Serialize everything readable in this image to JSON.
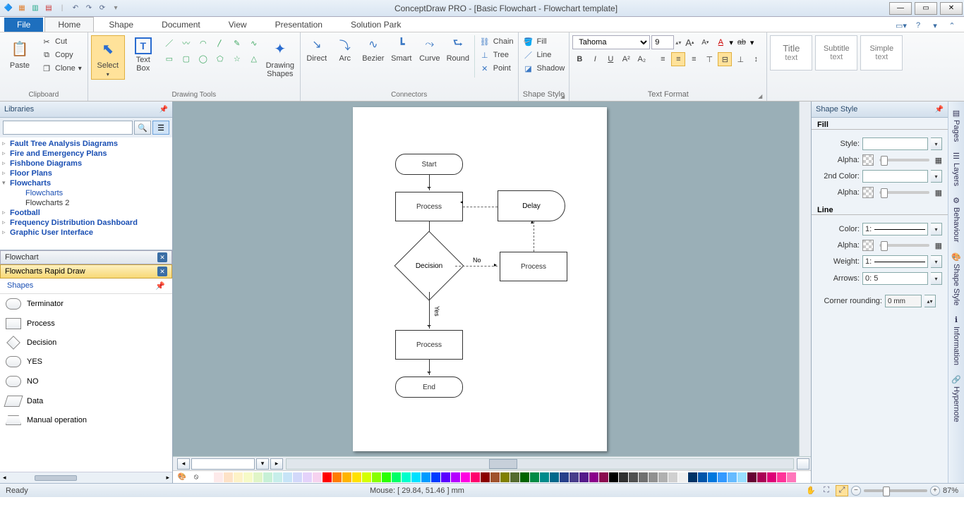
{
  "titlebar": {
    "title": "ConceptDraw PRO - [Basic Flowchart - Flowchart template]"
  },
  "menu": {
    "file": "File",
    "tabs": [
      "Home",
      "Shape",
      "Document",
      "View",
      "Presentation",
      "Solution Park"
    ],
    "active": 0
  },
  "ribbon": {
    "clipboard": {
      "label": "Clipboard",
      "paste": "Paste",
      "cut": "Cut",
      "copy": "Copy",
      "clone": "Clone"
    },
    "drawing": {
      "label": "Drawing Tools",
      "select": "Select",
      "textbox": "Text Box",
      "shapes": "Drawing Shapes"
    },
    "connectors": {
      "label": "Connectors",
      "items": [
        "Direct",
        "Arc",
        "Bezier",
        "Smart",
        "Curve",
        "Round"
      ],
      "side": [
        "Chain",
        "Tree",
        "Point"
      ]
    },
    "shapestyle": {
      "label": "Shape Style",
      "fill": "Fill",
      "line": "Line",
      "shadow": "Shadow"
    },
    "textformat": {
      "label": "Text Format",
      "font": "Tahoma",
      "size": "9"
    },
    "stylecards": {
      "title": {
        "t1": "Title",
        "t2": "text"
      },
      "subtitle": {
        "t1": "Subtitle",
        "t2": "text"
      },
      "simple": {
        "t1": "Simple",
        "t2": "text"
      }
    }
  },
  "left": {
    "hdr": "Libraries",
    "tree": [
      {
        "label": "Fault Tree Analysis Diagrams"
      },
      {
        "label": "Fire and Emergency Plans"
      },
      {
        "label": "Fishbone Diagrams"
      },
      {
        "label": "Floor Plans"
      },
      {
        "label": "Flowcharts",
        "open": true,
        "children": [
          {
            "label": "Flowcharts",
            "link": true
          },
          {
            "label": "Flowcharts 2",
            "link": false
          }
        ]
      },
      {
        "label": "Football"
      },
      {
        "label": "Frequency Distribution Dashboard"
      },
      {
        "label": "Graphic User Interface"
      }
    ],
    "stacks": [
      {
        "label": "Flowchart",
        "active": false
      },
      {
        "label": "Flowcharts Rapid Draw",
        "active": true
      }
    ],
    "shapesHdr": "Shapes",
    "shapes": [
      "Terminator",
      "Process",
      "Decision",
      "YES",
      "NO",
      "Data",
      "Manual operation"
    ]
  },
  "canvas": {
    "nodes": {
      "start": "Start",
      "proc1": "Process",
      "delay": "Delay",
      "decision": "Decision",
      "proc2": "Process",
      "proc3": "Process",
      "end": "End",
      "no": "No",
      "yes": "Yes"
    }
  },
  "right": {
    "hdr": "Shape Style",
    "fill": "Fill",
    "line": "Line",
    "labels": {
      "style": "Style:",
      "alpha": "Alpha:",
      "color2": "2nd Color:",
      "color": "Color:",
      "weight": "Weight:",
      "arrows": "Arrows:",
      "corner": "Corner rounding:"
    },
    "values": {
      "weight": "1:",
      "arrows": "0:            5",
      "corner": "0 mm",
      "lcolor": "1:"
    },
    "tabs": [
      "Pages",
      "Layers",
      "Behaviour",
      "Shape Style",
      "Information",
      "Hypernote"
    ]
  },
  "palette": [
    "#ffffff",
    "#fdeaea",
    "#fde2c7",
    "#fdf2c7",
    "#f6fac7",
    "#e0f5c7",
    "#c7f0d6",
    "#c7eeea",
    "#c7e4f7",
    "#d2d8fa",
    "#e4d2fa",
    "#f6d2ef",
    "#ff0000",
    "#ff7b00",
    "#ffb400",
    "#ffe100",
    "#d4ff00",
    "#88ff00",
    "#2bff00",
    "#00ff66",
    "#00ffcc",
    "#00e1ff",
    "#009bff",
    "#003cff",
    "#5a00ff",
    "#b400ff",
    "#ff00e1",
    "#ff006e",
    "#8b0000",
    "#a0522d",
    "#808000",
    "#556b2f",
    "#006400",
    "#008b45",
    "#008b8b",
    "#00688b",
    "#27408b",
    "#483d8b",
    "#551a8b",
    "#8b008b",
    "#8b0a50",
    "#000000",
    "#303030",
    "#505050",
    "#707070",
    "#909090",
    "#b0b0b0",
    "#d0d0d0",
    "#f0f0f0",
    "#003366",
    "#0055aa",
    "#0077dd",
    "#3399ff",
    "#66bbff",
    "#99ddff",
    "#660033",
    "#aa0055",
    "#dd0077",
    "#ff3399",
    "#ff77bb"
  ],
  "status": {
    "ready": "Ready",
    "mouse": "Mouse: [ 29.84, 51.46 ] mm",
    "zoom": "87%"
  }
}
